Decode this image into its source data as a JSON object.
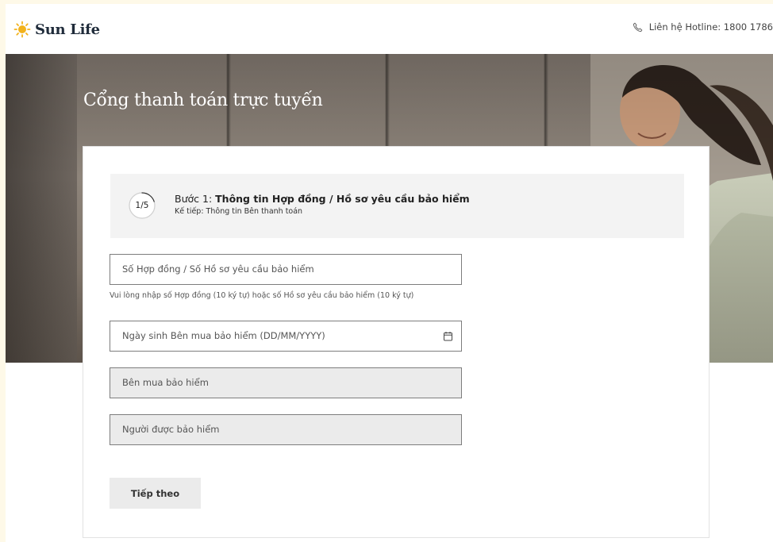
{
  "header": {
    "brand": "Sun Life",
    "hotline_label": "Liên hệ Hotline: 1800 1786"
  },
  "hero": {
    "title": "Cổng thanh toán trực tuyến"
  },
  "step": {
    "counter": "1/5",
    "prefix": "Bước 1: ",
    "title": "Thông tin Hợp đồng / Hồ sơ yêu cầu bảo hiểm",
    "next": "Kế tiếp: Thông tin Bên thanh toán",
    "progress_fraction": 0.2
  },
  "form": {
    "contract_placeholder": "Số Hợp đồng / Số Hồ sơ yêu cầu bảo hiểm",
    "contract_hint": "Vui lòng nhập số Hợp đồng (10 ký tự) hoặc số Hồ sơ yêu cầu bảo hiểm (10 ký tự)",
    "dob_placeholder": "Ngày sinh Bên mua bảo hiểm (DD/MM/YYYY)",
    "policyholder_placeholder": "Bên mua bảo hiểm",
    "insured_placeholder": "Người được bảo hiểm",
    "next_button": "Tiếp theo"
  },
  "icons": {
    "logo": "sun-logo-icon",
    "phone": "phone-icon",
    "calendar": "calendar-icon"
  },
  "colors": {
    "background": "#fef9e8",
    "brand_gold": "#f2b21c",
    "panel_gray": "#f3f3f3",
    "disabled_gray": "#ebebeb"
  }
}
